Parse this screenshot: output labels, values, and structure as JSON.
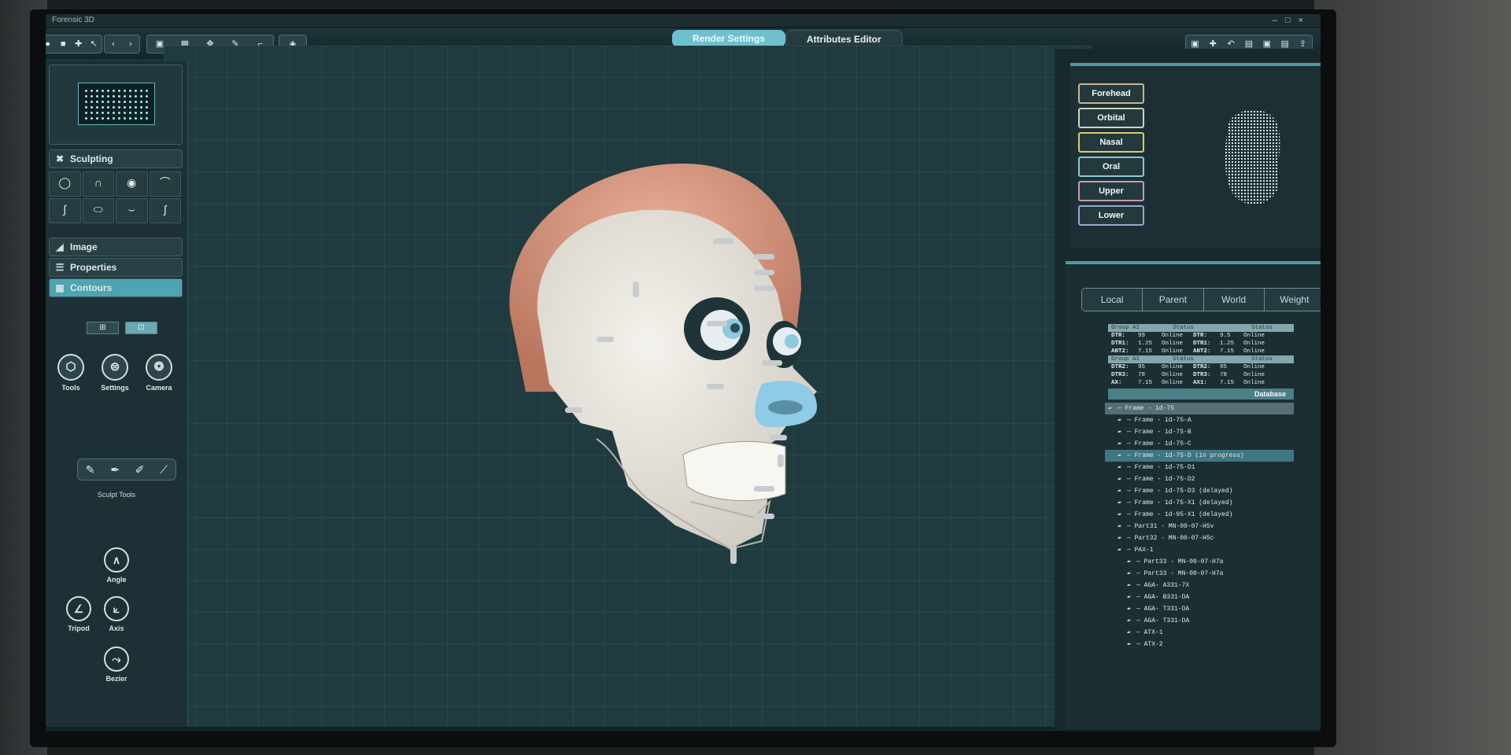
{
  "app": {
    "title": "Forensic 3D",
    "window_controls": [
      "–",
      "□",
      "×"
    ]
  },
  "toolbar": {
    "left_groups": [
      [
        "●",
        "■",
        "✚",
        "↖"
      ],
      [
        "‹",
        "›"
      ],
      [
        "▣",
        "▦",
        "✥",
        "✎",
        "⌐"
      ],
      [
        "◈"
      ]
    ],
    "right_buttons": [
      "▣",
      "✚",
      "↶",
      "▤",
      "▣",
      "▤",
      "⇪"
    ]
  },
  "tabs": [
    {
      "label": "Render Settings",
      "active": true
    },
    {
      "label": "Attributes Editor",
      "active": false
    }
  ],
  "left_panel": {
    "sections": [
      {
        "label": "Sculpting",
        "icon": "wrench-icon",
        "glyph": "✖"
      },
      {
        "label": "Image",
        "icon": "image-icon",
        "glyph": "◢"
      },
      {
        "label": "Properties",
        "icon": "list-icon",
        "glyph": "☰"
      },
      {
        "label": "Contours",
        "icon": "contour-icon",
        "glyph": "▦"
      }
    ],
    "sculpt_tool_icons": [
      "◯",
      "∩",
      "◉",
      "⌒",
      "∫",
      "⬭",
      "⌣",
      "ʃ"
    ],
    "mode_icons": [
      "⊞",
      "⊡"
    ],
    "big_tools": [
      {
        "label": "Tools",
        "glyph": "⬡"
      },
      {
        "label": "Settings",
        "glyph": "⊜"
      },
      {
        "label": "Camera",
        "glyph": "❂"
      }
    ],
    "brush_icons": [
      "✎",
      "✒",
      "✐",
      "⟋"
    ],
    "sculpt_tools_label": "Sculpt Tools",
    "controls": [
      {
        "label": "Angle",
        "glyph": "∧"
      },
      {
        "label": "Tripod",
        "glyph": "∠"
      },
      {
        "label": "Axis",
        "glyph": "⟀"
      },
      {
        "label": "Bezier",
        "glyph": "⤳"
      }
    ]
  },
  "right_panel": {
    "regions": [
      {
        "label": "Forehead",
        "color": "#c9b68a"
      },
      {
        "label": "Orbital",
        "color": "#c8d6c2"
      },
      {
        "label": "Nasal",
        "color": "#d8cc6a"
      },
      {
        "label": "Oral",
        "color": "#8fc6d6"
      },
      {
        "label": "Upper",
        "color": "#c79ab3"
      },
      {
        "label": "Lower",
        "color": "#9aa6d4"
      }
    ],
    "space_tabs": [
      "Local",
      "Parent",
      "World",
      "Weight"
    ],
    "table": {
      "group1": {
        "header": [
          "Group A1",
          "Status",
          "",
          "Status"
        ],
        "rows": [
          [
            "DTR:",
            "99",
            "Online",
            "DTR:",
            "9.5",
            "Online"
          ],
          [
            "DTR1:",
            "1.25",
            "Online",
            "DTR1:",
            "1.25",
            "Online"
          ],
          [
            "ANT2:",
            "7.15",
            "Online",
            "ANT2:",
            "7.15",
            "Online"
          ]
        ]
      },
      "group2": {
        "header": [
          "Group A1",
          "Status",
          "",
          "Status"
        ],
        "rows": [
          [
            "DTR2:",
            "95",
            "Online",
            "DTR2:",
            "95",
            "Online"
          ],
          [
            "DTR3:",
            "78",
            "Online",
            "DTR3:",
            "78",
            "Online"
          ],
          [
            "AX:",
            "7.15",
            "Online",
            "AX1:",
            "7.15",
            "Online"
          ]
        ]
      },
      "database_label": "Database"
    },
    "tree": [
      {
        "label": "Frame - 1d-75",
        "level": 0,
        "style": "hl"
      },
      {
        "label": "Frame - 1d-75-A",
        "level": 1
      },
      {
        "label": "Frame - 1d-75-B",
        "level": 1
      },
      {
        "label": "Frame - 1d-75-C",
        "level": 1
      },
      {
        "label": "Frame - 1d-75-D (in progress)",
        "level": 1,
        "style": "sel"
      },
      {
        "label": "Frame - 1d-75-D1",
        "level": 1
      },
      {
        "label": "Frame - 1d-75-D2",
        "level": 1
      },
      {
        "label": "Frame - 1d-75-D3 (delayed)",
        "level": 1
      },
      {
        "label": "Frame - 1d-75-X1 (delayed)",
        "level": 1
      },
      {
        "label": "Frame - 1d-95-X1 (delayed)",
        "level": 1
      },
      {
        "label": "Part31 - MN-00-07-H5v",
        "level": 1
      },
      {
        "label": "Part32 - MN-00-07-H5c",
        "level": 1
      },
      {
        "label": "PAX-1",
        "level": 1
      },
      {
        "label": "Part33 - MN-00-07-H7a",
        "level": 2
      },
      {
        "label": "Part33 - MN-00-07-H7a",
        "level": 2
      },
      {
        "label": "AGA- A331-7X",
        "level": 2
      },
      {
        "label": "AGA- B331-DA",
        "level": 2
      },
      {
        "label": "AGA- T331-DA",
        "level": 2
      },
      {
        "label": "AGA- T331-DA",
        "level": 2
      },
      {
        "label": "ATX-1",
        "level": 2
      },
      {
        "label": "ATX-2",
        "level": 2
      }
    ]
  }
}
